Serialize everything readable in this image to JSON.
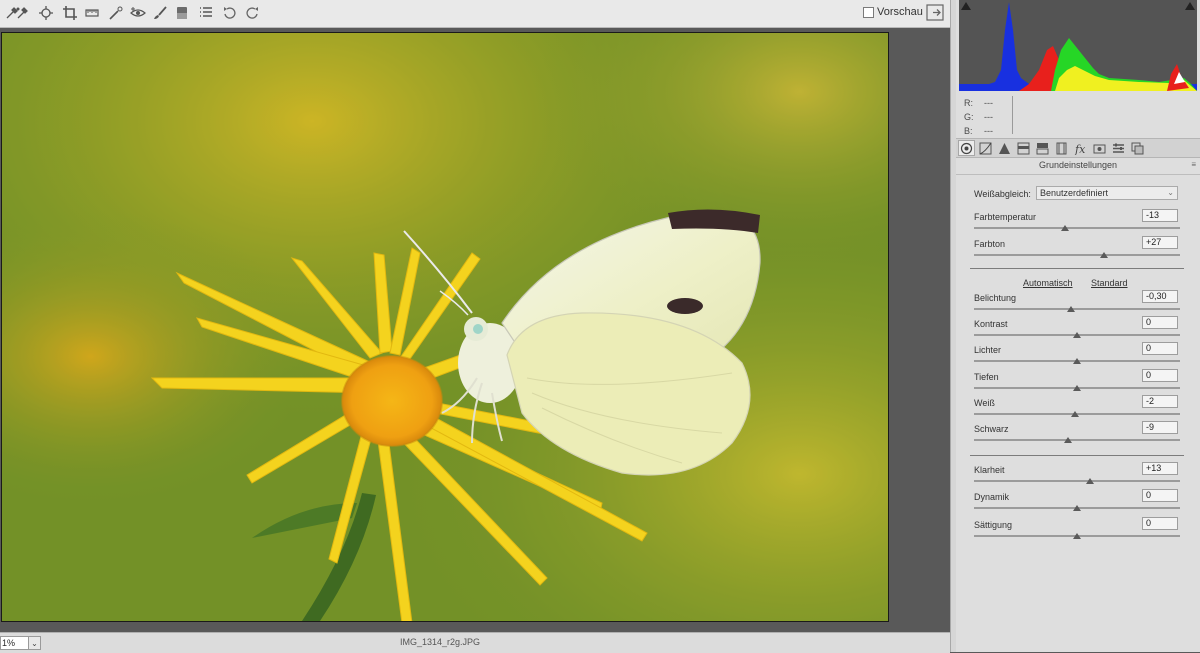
{
  "toolbar": {
    "tools": [
      "eyedropper-icon",
      "color-sampler-icon",
      "target-adjust-icon",
      "crop-icon",
      "straighten-icon",
      "spot-removal-icon",
      "red-eye-icon",
      "adjustment-brush-icon",
      "graduated-filter-icon",
      "preferences-icon",
      "rotate-left-icon",
      "rotate-right-icon"
    ],
    "preview_label": "Vorschau",
    "preview_checked": false
  },
  "bottom": {
    "zoom_value": "1%",
    "filename": "IMG_1314_r2g.JPG"
  },
  "histogram": {
    "r": "---",
    "g": "---",
    "b": "---",
    "r_label": "R:",
    "g_label": "G:",
    "b_label": "B:"
  },
  "panel": {
    "title": "Grundeinstellungen",
    "menu_icon": "≡",
    "white_balance_label": "Weißabgleich:",
    "white_balance_value": "Benutzerdefiniert",
    "auto_label": "Automatisch",
    "default_label": "Standard",
    "sliders": [
      {
        "label": "Farbtemperatur",
        "value": "-13",
        "pos": 0.44
      },
      {
        "label": "Farbton",
        "value": "+27",
        "pos": 0.63
      },
      {
        "label": "Belichtung",
        "value": "-0,30",
        "pos": 0.47
      },
      {
        "label": "Kontrast",
        "value": "0",
        "pos": 0.5
      },
      {
        "label": "Lichter",
        "value": "0",
        "pos": 0.5
      },
      {
        "label": "Tiefen",
        "value": "0",
        "pos": 0.5
      },
      {
        "label": "Weiß",
        "value": "-2",
        "pos": 0.49
      },
      {
        "label": "Schwarz",
        "value": "-9",
        "pos": 0.455
      },
      {
        "label": "Klarheit",
        "value": "+13",
        "pos": 0.565
      },
      {
        "label": "Dynamik",
        "value": "0",
        "pos": 0.5
      },
      {
        "label": "Sättigung",
        "value": "0",
        "pos": 0.5
      }
    ]
  }
}
